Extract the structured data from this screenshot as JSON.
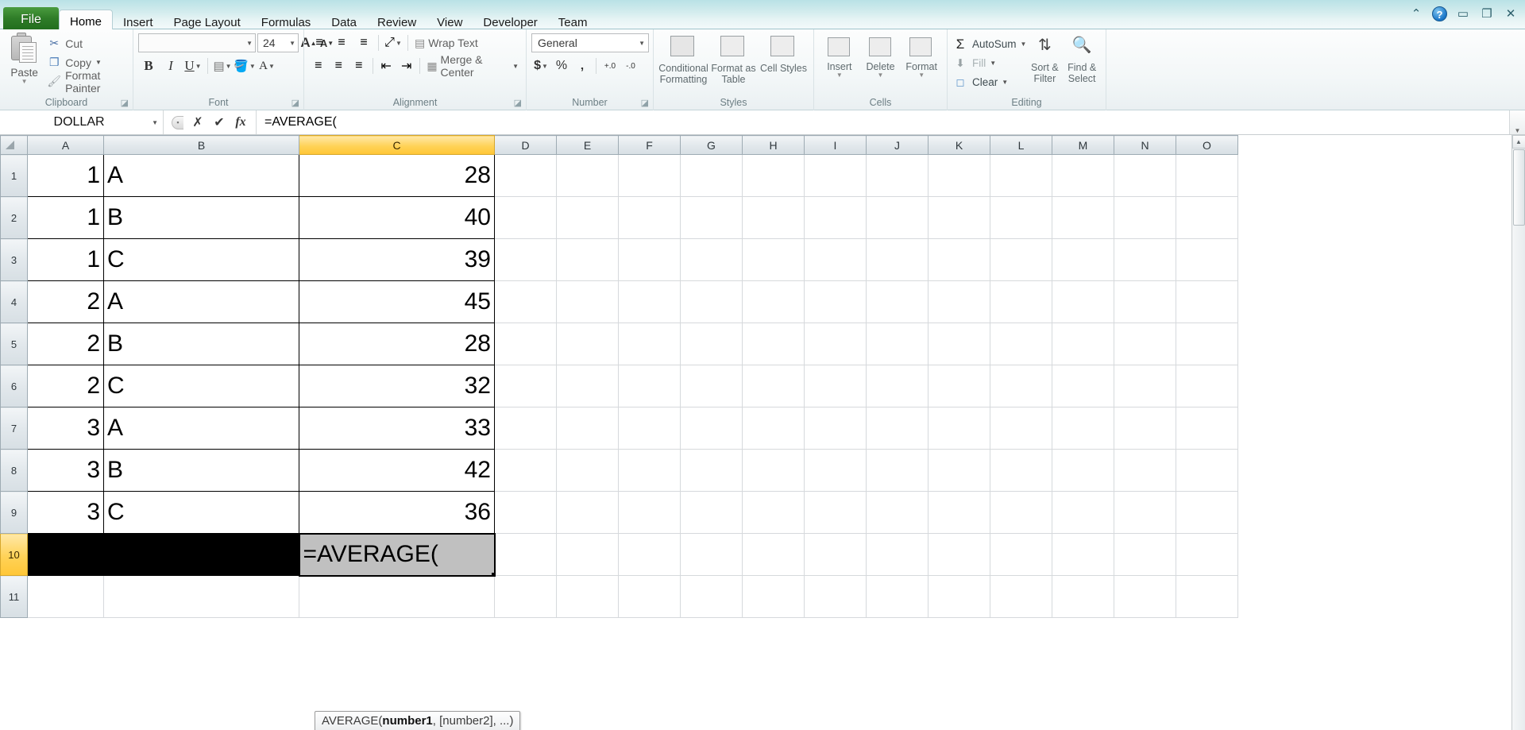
{
  "window": {
    "controls": [
      "ribbon-collapse",
      "help",
      "minimize",
      "restore",
      "close"
    ],
    "collapse_glyph": "⌃",
    "help_glyph": "?",
    "minimize_glyph": "▭",
    "restore_glyph": "❐",
    "close_glyph": "✕"
  },
  "ribbon": {
    "file_tab": "File",
    "tabs": [
      "Home",
      "Insert",
      "Page Layout",
      "Formulas",
      "Data",
      "Review",
      "View",
      "Developer",
      "Team"
    ],
    "active_tab": "Home",
    "groups": {
      "clipboard": {
        "label": "Clipboard",
        "paste": "Paste",
        "cut": "Cut",
        "copy": "Copy",
        "format_painter": "Format Painter",
        "dialog_launcher": "◪"
      },
      "font": {
        "label": "Font",
        "font_name": "",
        "font_name_placeholder": "",
        "font_size": "24",
        "bold": "B",
        "italic": "I",
        "underline": "U",
        "grow_font": "A",
        "shrink_font": "A",
        "borders": "▦",
        "fill_color": "A",
        "font_color": "A",
        "dialog_launcher": "◪"
      },
      "alignment": {
        "label": "Alignment",
        "wrap_text": "Wrap Text",
        "merge_center": "Merge & Center",
        "dialog_launcher": "◪"
      },
      "number": {
        "label": "Number",
        "format": "General",
        "currency": "$",
        "percent": "%",
        "comma": "‚",
        "increase_decimal": "+.0",
        "decrease_decimal": "-.0",
        "dialog_launcher": "◪"
      },
      "styles": {
        "label": "Styles",
        "conditional_formatting": "Conditional Formatting",
        "format_as_table": "Format as Table",
        "cell_styles": "Cell Styles"
      },
      "cells": {
        "label": "Cells",
        "insert": "Insert",
        "delete": "Delete",
        "format": "Format"
      },
      "editing": {
        "label": "Editing",
        "autosum": "AutoSum",
        "fill": "Fill",
        "clear": "Clear",
        "sort_filter": "Sort & Filter",
        "find_select": "Find & Select",
        "sigma": "Σ"
      }
    }
  },
  "formula_bar": {
    "name_box": "DOLLAR",
    "cancel_glyph": "✗",
    "enter_glyph": "✔",
    "insert_function_glyph": "fx",
    "formula": "=AVERAGE("
  },
  "sheet": {
    "columns": [
      "A",
      "B",
      "C",
      "D",
      "E",
      "F",
      "G",
      "H",
      "I",
      "J",
      "K",
      "L",
      "M",
      "N",
      "O"
    ],
    "selected_column": "C",
    "selected_row": "10",
    "rows": [
      {
        "num": "1",
        "a": "1",
        "b": "A",
        "c": "28"
      },
      {
        "num": "2",
        "a": "1",
        "b": "B",
        "c": "40"
      },
      {
        "num": "3",
        "a": "1",
        "b": "C",
        "c": "39"
      },
      {
        "num": "4",
        "a": "2",
        "b": "A",
        "c": "45"
      },
      {
        "num": "5",
        "a": "2",
        "b": "B",
        "c": "28"
      },
      {
        "num": "6",
        "a": "2",
        "b": "C",
        "c": "32"
      },
      {
        "num": "7",
        "a": "3",
        "b": "A",
        "c": "33"
      },
      {
        "num": "8",
        "a": "3",
        "b": "B",
        "c": "42"
      },
      {
        "num": "9",
        "a": "3",
        "b": "C",
        "c": "36"
      }
    ],
    "edit_row": {
      "num": "10",
      "c": "=AVERAGE("
    },
    "last_row": {
      "num": "11"
    },
    "tooltip": {
      "prefix": "AVERAGE(",
      "bold": "number1",
      "suffix": ", [number2], ...)"
    }
  },
  "colors": {
    "header_selected": "#ffd257",
    "excel_green": "#2f7d28",
    "edit_cell_bg": "#c0c0c0",
    "black_fill": "#000000"
  }
}
